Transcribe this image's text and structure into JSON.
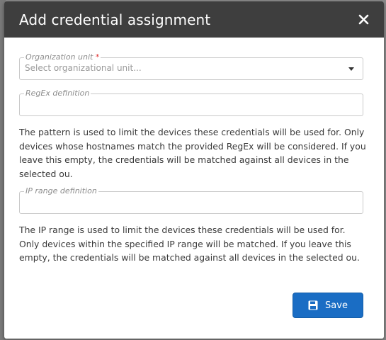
{
  "dialog": {
    "title": "Add credential assignment",
    "close_icon": "close-icon"
  },
  "org_unit": {
    "label": "Organization unit",
    "required_mark": "*",
    "placeholder": "Select organizational unit..."
  },
  "regex": {
    "label": "RegEx definition",
    "value": ""
  },
  "regex_help": "The pattern is used to limit the devices these credentials will be used for. Only devices whose hostnames match the provided RegEx will be considered. If you leave this empty, the credentials will be matched against all devices in the selected ou.",
  "ip_range": {
    "label": "IP range definition",
    "value": ""
  },
  "ip_help": "The IP range is used to limit the devices these credentials will be used for. Only devices within the specified IP range will be matched. If you leave this empty, the credentials will be matched against all devices in the selected ou.",
  "save": {
    "label": "Save",
    "icon": "floppy-disk-icon"
  },
  "colors": {
    "header_bg": "#3e3e3e",
    "primary": "#1a6dc4",
    "required": "#e03131"
  }
}
